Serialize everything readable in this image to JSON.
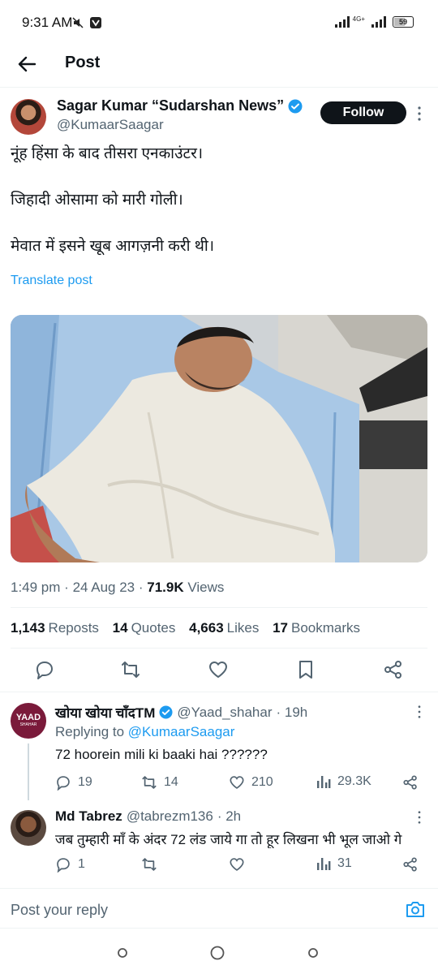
{
  "status_bar": {
    "time": "9:31 AM",
    "network": "4G+",
    "battery": "59"
  },
  "header": {
    "title": "Post"
  },
  "author": {
    "name": "Sagar Kumar “Sudarshan News”",
    "handle": "@KumaarSaagar",
    "follow_label": "Follow"
  },
  "post": {
    "lines": [
      "नूंह हिंसा के बाद तीसरा एनकाउंटर।",
      "जिहादी ओसामा को मारी गोली।",
      "मेवात में इसने खूब आगज़नी करी थी।"
    ],
    "translate_label": "Translate post",
    "time": "1:49 pm",
    "date": "24 Aug 23",
    "views_count": "71.9K",
    "views_label": "Views"
  },
  "stats": {
    "reposts_count": "1,143",
    "reposts_label": "Reposts",
    "quotes_count": "14",
    "quotes_label": "Quotes",
    "likes_count": "4,663",
    "likes_label": "Likes",
    "bookmarks_count": "17",
    "bookmarks_label": "Bookmarks"
  },
  "replies": [
    {
      "name": "खोया खोया चाँदTM",
      "handle": "@Yaad_shahar",
      "age": "· 19h",
      "avatar_text": "YAAD",
      "avatar_subtext": "SHAHAR",
      "replying_prefix": "Replying to",
      "replying_to": "@KumaarSaagar",
      "text": "72 hoorein mili ki baaki hai ??????",
      "replies": "19",
      "reposts": "14",
      "likes": "210",
      "views": "29.3K"
    },
    {
      "name": "Md Tabrez",
      "handle": "@tabrezm136",
      "age": "· 2h",
      "text": "जब तुम्हारी माँ के अंदर 72 लंड जाये गा तो हूर लिखना भी भूल जाओ गे",
      "replies": "1",
      "reposts": "",
      "likes": "",
      "views": "31"
    }
  ],
  "reply_bar": {
    "placeholder": "Post your reply"
  },
  "colors": {
    "accent": "#1d9bf0",
    "text": "#0f1419",
    "muted": "#536471",
    "verified": "#1d9bf0"
  }
}
